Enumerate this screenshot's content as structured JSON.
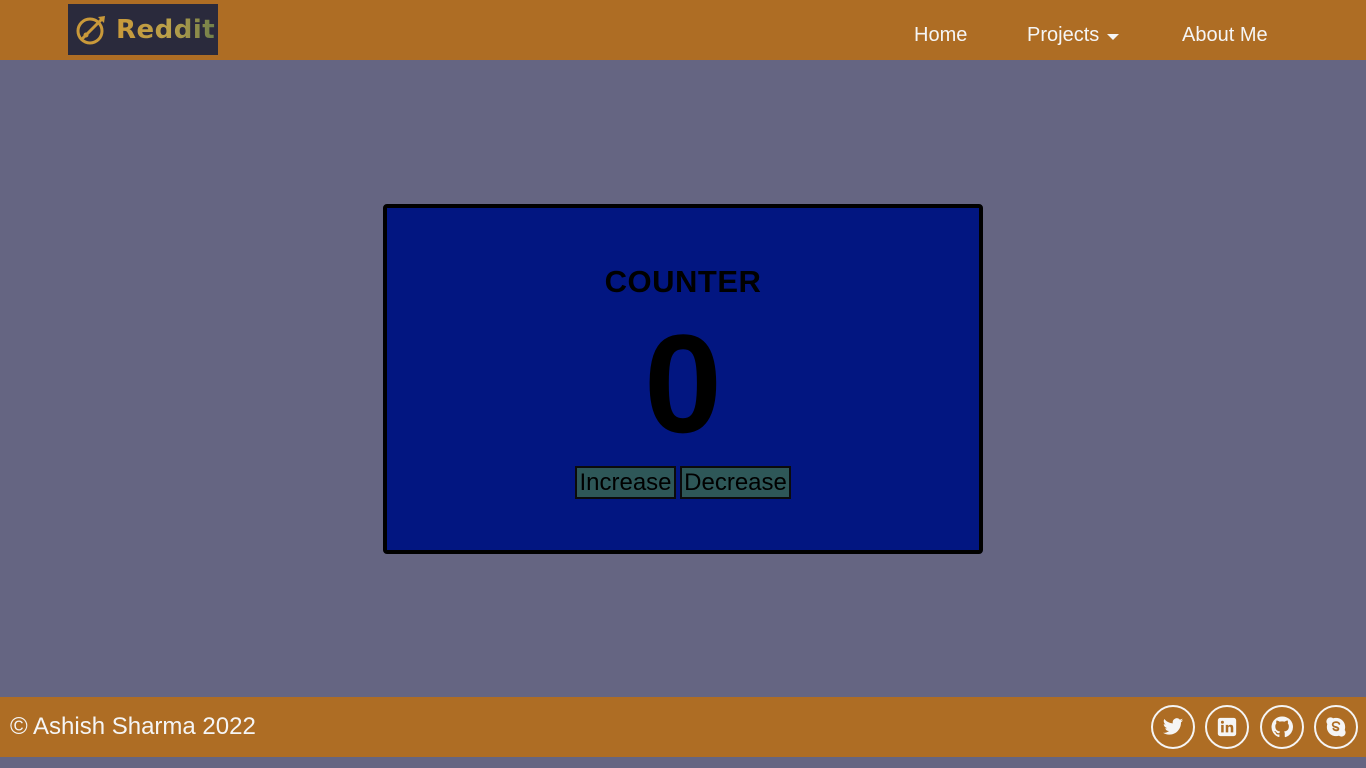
{
  "header": {
    "logo_text": "Reddit",
    "nav": {
      "home": "Home",
      "projects": "Projects",
      "about": "About Me"
    }
  },
  "counter": {
    "title": "COUNTER",
    "value": "0",
    "increase_label": "Increase",
    "decrease_label": "Decrease"
  },
  "footer": {
    "copyright": "© Ashish Sharma 2022",
    "social": [
      "twitter-icon",
      "linkedin-icon",
      "github-icon",
      "skype-icon"
    ]
  },
  "colors": {
    "background": "#656582",
    "bar": "#ae6d24",
    "card": "#021681",
    "button": "#2e5758",
    "nav_text": "#f5f5f5"
  }
}
